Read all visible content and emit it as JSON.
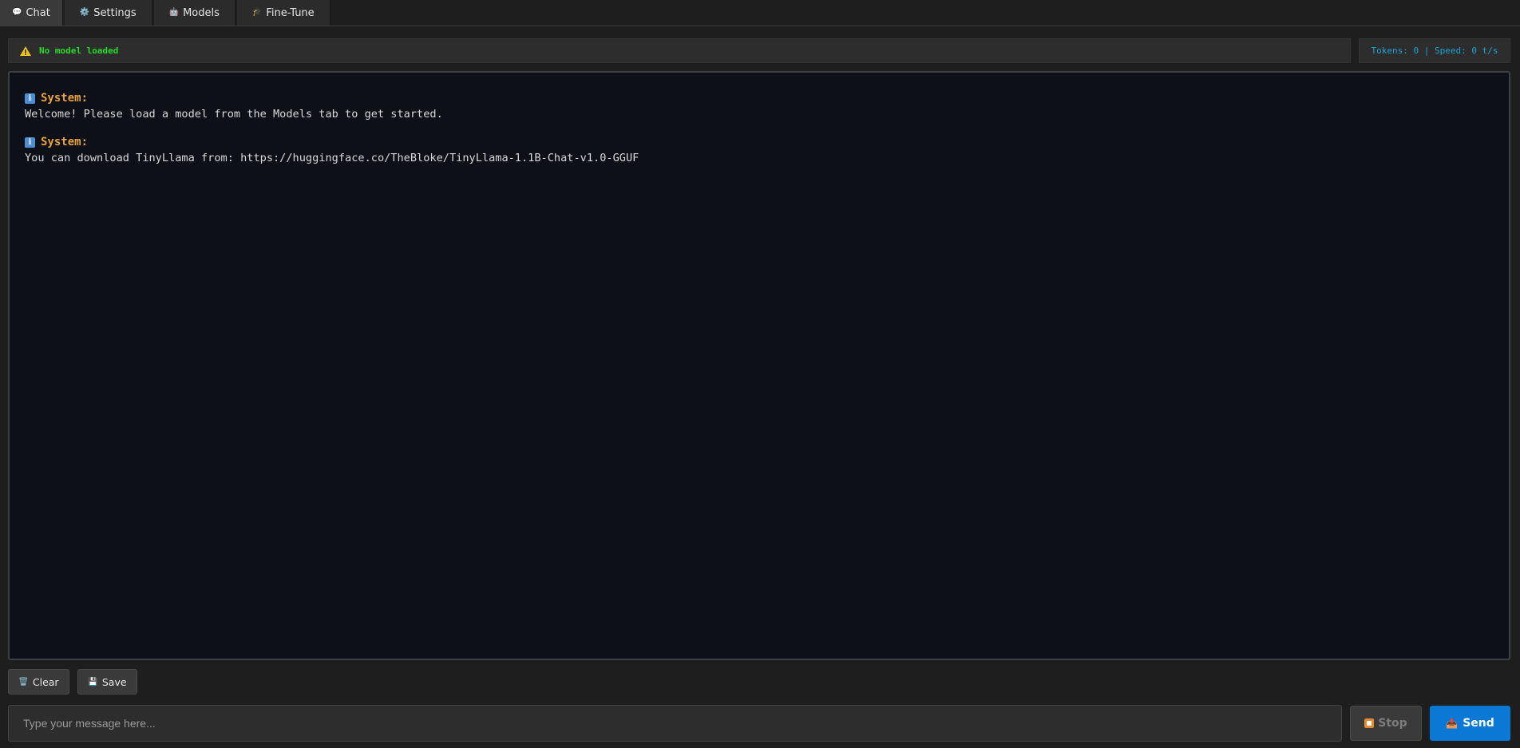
{
  "tabs": [
    {
      "label": "Chat",
      "icon": "speech-bubble-icon"
    },
    {
      "label": "Settings",
      "icon": "gear-icon"
    },
    {
      "label": "Models",
      "icon": "robot-icon"
    },
    {
      "label": "Fine-Tune",
      "icon": "graduation-cap-icon"
    }
  ],
  "status": {
    "model": "No model loaded",
    "stats": "Tokens: 0 | Speed: 0 t/s",
    "model_color": "#22dd22",
    "stats_color": "#1aa3d6"
  },
  "messages": [
    {
      "role": "System:",
      "text": "Welcome! Please load a model from the Models tab to get started."
    },
    {
      "role": "System:",
      "text": "You can download TinyLlama from: https://huggingface.co/TheBloke/TinyLlama-1.1B-Chat-v1.0-GGUF"
    }
  ],
  "actions": {
    "clear_label": "Clear",
    "save_label": "Save"
  },
  "composer": {
    "placeholder": "Type your message here...",
    "value": "",
    "stop_label": "Stop",
    "send_label": "Send",
    "send_color": "#0a78d4"
  }
}
